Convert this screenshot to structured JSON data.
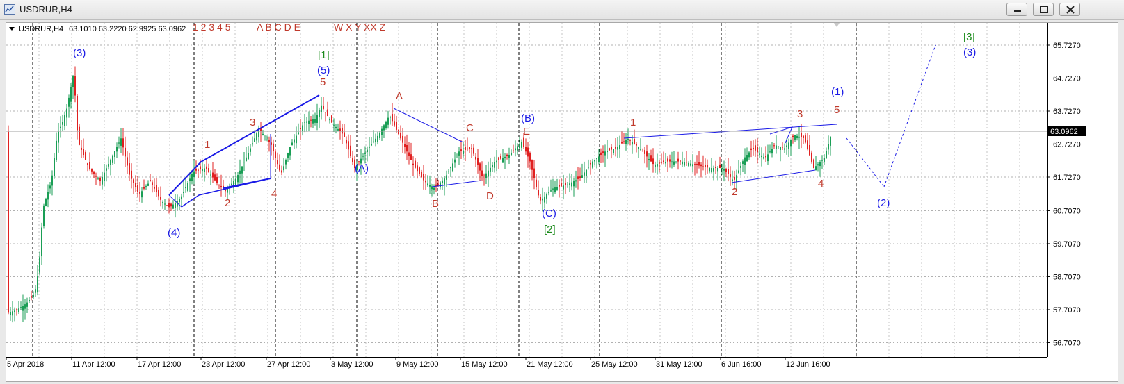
{
  "window": {
    "title": "USDRUR,H4",
    "buttons": {
      "minimize": "minimize-icon",
      "maximize": "maximize-icon",
      "close": "close-icon"
    }
  },
  "chart_header": {
    "symbol_tf": "USDRUR,H4",
    "ohlc": "63.1010 63.2220 62.9925 63.0962"
  },
  "wave_labels_top": {
    "set1": "1 2 3 4 5",
    "set2": "A B C D E",
    "set3": "W X Y XX Z"
  },
  "chart_data": {
    "type": "candlestick",
    "title": "USDRUR,H4",
    "ylim": [
      56.2,
      66.7
    ],
    "yticks": [
      "65.7270",
      "64.7270",
      "63.7270",
      "62.7270",
      "61.7270",
      "60.7070",
      "59.7070",
      "58.7070",
      "57.7070",
      "56.7070"
    ],
    "xticks": [
      "5 Apr 2018",
      "11 Apr 12:00",
      "17 Apr 12:00",
      "23 Apr 12:00",
      "27 Apr 12:00",
      "3 May 12:00",
      "9 May 12:00",
      "15 May 12:00",
      "21 May 12:00",
      "25 May 12:00",
      "31 May 12:00",
      "6 Jun 16:00",
      "12 Jun 16:00"
    ],
    "current_price": "63.0962",
    "bars_approx": [
      {
        "date": "5 Apr 2018",
        "close": 57.6
      },
      {
        "date": "10 Apr",
        "close": 64.9
      },
      {
        "date": "17 Apr",
        "close": 60.8
      },
      {
        "date": "19 Apr",
        "close": 62.0
      },
      {
        "date": "23 Apr",
        "close": 61.3
      },
      {
        "date": "25 Apr",
        "close": 63.2
      },
      {
        "date": "26 Apr",
        "close": 61.8
      },
      {
        "date": "2 May",
        "close": 63.9
      },
      {
        "date": "3 May",
        "close": 62.0
      },
      {
        "date": "8 May",
        "close": 63.6
      },
      {
        "date": "11 May",
        "close": 61.4
      },
      {
        "date": "15 May",
        "close": 62.5
      },
      {
        "date": "16 May",
        "close": 61.7
      },
      {
        "date": "20 May",
        "close": 62.8
      },
      {
        "date": "22 May",
        "close": 61.0
      },
      {
        "date": "25 May",
        "close": 62.9
      },
      {
        "date": "6 Jun",
        "close": 61.6
      },
      {
        "date": "11 Jun",
        "close": 63.0
      },
      {
        "date": "13 Jun",
        "close": 62.0
      },
      {
        "date": "14 Jun",
        "close": 63.1
      }
    ],
    "wave_annotations": [
      "(3)",
      "(4)",
      "1",
      "2",
      "3",
      "4",
      "[1]",
      "(5)",
      "5",
      "(A)",
      "A",
      "B",
      "C",
      "D",
      "(B)",
      "E",
      "(C)",
      "[2]",
      "1",
      "2",
      "3",
      "4",
      "(1)",
      "5",
      "(2)",
      "[3]",
      "(3)"
    ]
  },
  "colors": {
    "bull": "#1a9e55",
    "bear": "#e02020",
    "wave_red": "#c0392b",
    "wave_blue": "#1a1ae6",
    "wave_green": "#1a8a1a",
    "price_tag_bg": "#000000"
  }
}
